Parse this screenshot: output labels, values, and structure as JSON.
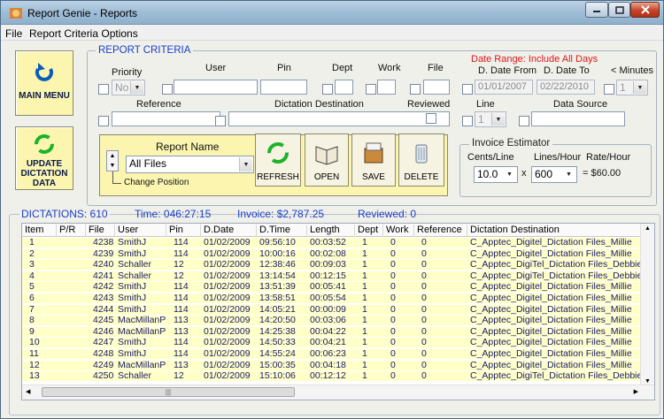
{
  "window": {
    "title": "Report Genie - Reports"
  },
  "menu": [
    "File",
    "Report Criteria Options"
  ],
  "buttons": {
    "main_menu": "MAIN MENU",
    "update": "UPDATE DICTATION DATA",
    "refresh": "REFRESH",
    "open": "OPEN",
    "save": "SAVE",
    "delete": "DELETE"
  },
  "criteria": {
    "legend": "REPORT CRITERIA",
    "priority_label": "Priority",
    "priority_value": "No",
    "user_label": "User",
    "pin_label": "Pin",
    "dept_label": "Dept",
    "work_label": "Work",
    "file_label": "File",
    "date_range": "Date Range:  Include All Days",
    "d_date_from_label": "D. Date From",
    "d_date_from": "01/01/2007",
    "d_date_to_label": "D. Date To",
    "d_date_to": "02/22/2010",
    "minutes_label": "< Minutes",
    "minutes_value": "1",
    "reference_label": "Reference",
    "dest_label": "Dictation Destination",
    "reviewed_label": "Reviewed",
    "line_label": "Line",
    "line_value": "1",
    "source_label": "Data Source"
  },
  "report": {
    "title": "Report Name",
    "value": "All Files",
    "change_position": "Change Position"
  },
  "invoice": {
    "legend": "Invoice Estimator",
    "cents_label": "Cents/Line",
    "cents_value": "10.0",
    "lph_label": "Lines/Hour",
    "lph_value": "600",
    "rate_label": "Rate/Hour",
    "times": "x",
    "rate_value": "= $60.00"
  },
  "summary": {
    "dictations": "DICTATIONS:  610",
    "time": "Time: 046:27:15",
    "invoice": "Invoice: $2,787.25",
    "reviewed": "Reviewed: 0"
  },
  "table": {
    "headers": [
      "Item",
      "P/R",
      "File",
      "User",
      "Pin",
      "D.Date",
      "D.Time",
      "Length",
      "Dept",
      "Work",
      "Reference",
      "Dictation Destination"
    ],
    "rows": [
      [
        "1",
        "",
        "4238",
        "SmithJ",
        "114",
        "01/02/2009",
        "09:56:10",
        "00:03:52",
        "1",
        "0",
        "0",
        "C_Apptec_Digitel_Dictation Files_Millie"
      ],
      [
        "2",
        "",
        "4239",
        "SmithJ",
        "114",
        "01/02/2009",
        "10:00:16",
        "00:02:08",
        "1",
        "0",
        "0",
        "C_Apptec_Digitel_Dictation Files_Millie"
      ],
      [
        "3",
        "",
        "4240",
        "Schaller",
        "12",
        "01/02/2009",
        "12:38:46",
        "00:09:03",
        "1",
        "0",
        "0",
        "C_Apptec_DigiTel_Dictation Files_Debbie"
      ],
      [
        "4",
        "",
        "4241",
        "Schaller",
        "12",
        "01/02/2009",
        "13:14:54",
        "00:12:15",
        "1",
        "0",
        "0",
        "C_Apptec_DigiTel_Dictation Files_Debbie"
      ],
      [
        "5",
        "",
        "4242",
        "SmithJ",
        "114",
        "01/02/2009",
        "13:51:39",
        "00:05:41",
        "1",
        "0",
        "0",
        "C_Apptec_Digitel_Dictation Files_Millie"
      ],
      [
        "6",
        "",
        "4243",
        "SmithJ",
        "114",
        "01/02/2009",
        "13:58:51",
        "00:05:54",
        "1",
        "0",
        "0",
        "C_Apptec_Digitel_Dictation Files_Millie"
      ],
      [
        "7",
        "",
        "4244",
        "SmithJ",
        "114",
        "01/02/2009",
        "14:05:21",
        "00:00:09",
        "1",
        "0",
        "0",
        "C_Apptec_Digitel_Dictation Files_Millie"
      ],
      [
        "8",
        "",
        "4245",
        "MacMillanP",
        "113",
        "01/02/2009",
        "14:20:50",
        "00:03:06",
        "1",
        "0",
        "0",
        "C_Apptec_Digitel_Dictation Files_Millie"
      ],
      [
        "9",
        "",
        "4246",
        "MacMillanP",
        "113",
        "01/02/2009",
        "14:25:38",
        "00:04:22",
        "1",
        "0",
        "0",
        "C_Apptec_Digitel_Dictation Files_Millie"
      ],
      [
        "10",
        "",
        "4247",
        "SmithJ",
        "114",
        "01/02/2009",
        "14:50:33",
        "00:04:21",
        "1",
        "0",
        "0",
        "C_Apptec_Digitel_Dictation Files_Millie"
      ],
      [
        "11",
        "",
        "4248",
        "SmithJ",
        "114",
        "01/02/2009",
        "14:55:24",
        "00:06:23",
        "1",
        "0",
        "0",
        "C_Apptec_Digitel_Dictation Files_Millie"
      ],
      [
        "12",
        "",
        "4249",
        "MacMillanP",
        "113",
        "01/02/2009",
        "15:00:35",
        "00:04:18",
        "1",
        "0",
        "0",
        "C_Apptec_Digitel_Dictation Files_Millie"
      ],
      [
        "13",
        "",
        "4250",
        "Schaller",
        "12",
        "01/02/2009",
        "15:10:06",
        "00:12:12",
        "1",
        "0",
        "0",
        "C_Apptec_DigiTel_Dictation Files_Debbie"
      ]
    ]
  }
}
